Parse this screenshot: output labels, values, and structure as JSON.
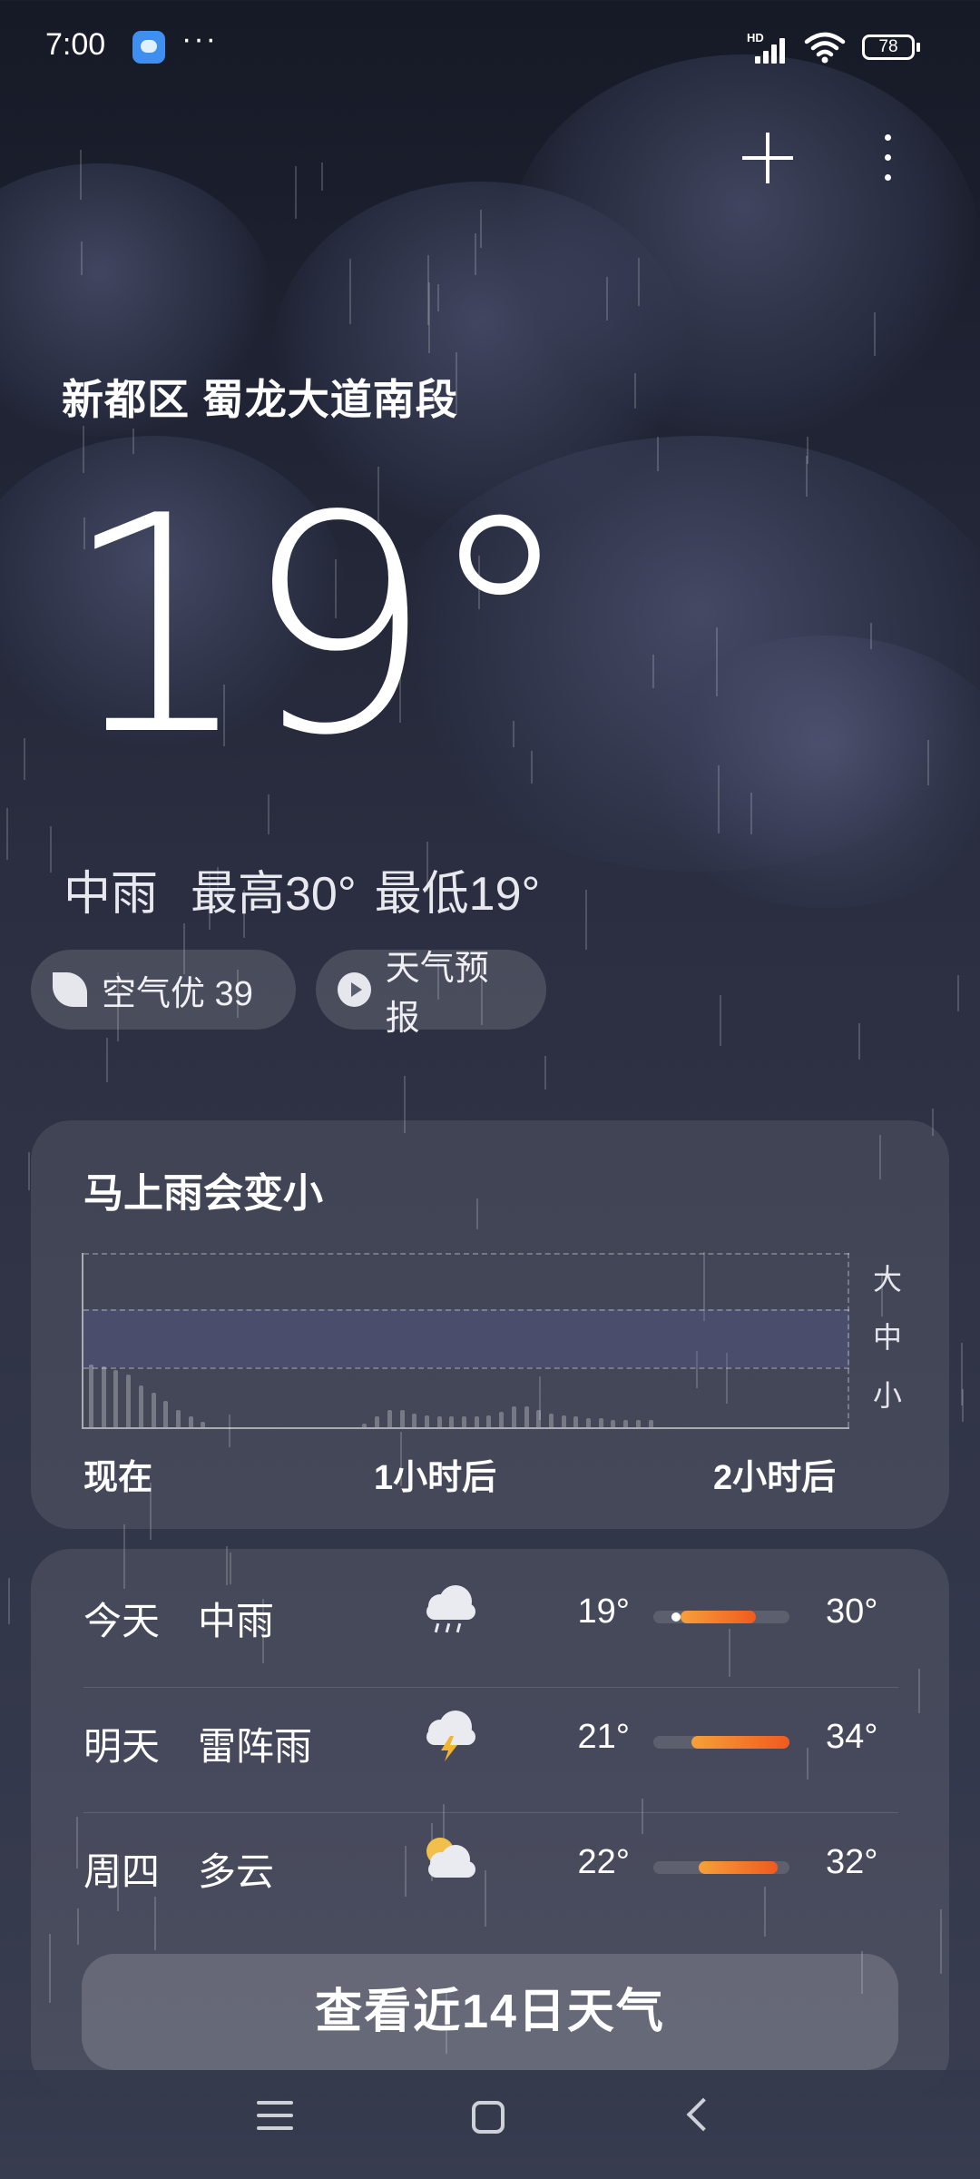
{
  "status_bar": {
    "time": "7:00",
    "dots": "···",
    "hd": "HD",
    "battery": "78"
  },
  "header": {
    "add_icon": "plus-icon",
    "more_icon": "more-vertical-icon"
  },
  "current": {
    "location": "新都区 蜀龙大道南段",
    "temperature": "19°",
    "condition": "中雨",
    "high": "最高30°",
    "low": "最低19°",
    "air_quality": "空气优 39",
    "forecast_button": "天气预报"
  },
  "rain_card": {
    "title": "马上雨会变小",
    "y_levels": [
      "大",
      "中",
      "小"
    ],
    "x_labels": [
      "现在",
      "1小时后",
      "2小时后"
    ]
  },
  "chart_data": {
    "type": "bar",
    "title": "马上雨会变小",
    "x_ticks": [
      "现在",
      "1小时后",
      "2小时后"
    ],
    "y_ticks": [
      "大",
      "中",
      "小"
    ],
    "values": [
      0.36,
      0.35,
      0.33,
      0.3,
      0.24,
      0.2,
      0.15,
      0.1,
      0.06,
      0.03,
      0,
      0,
      0,
      0,
      0,
      0,
      0,
      0,
      0,
      0,
      0,
      0,
      0.02,
      0.06,
      0.1,
      0.1,
      0.08,
      0.07,
      0.06,
      0.06,
      0.06,
      0.06,
      0.07,
      0.09,
      0.12,
      0.12,
      0.1,
      0.08,
      0.07,
      0.06,
      0.05,
      0.05,
      0.04,
      0.04,
      0.04,
      0.04,
      0,
      0,
      0,
      0,
      0,
      0,
      0,
      0,
      0,
      0,
      0,
      0,
      0,
      0
    ]
  },
  "daily": [
    {
      "day": "今天",
      "condition": "中雨",
      "icon": "rain-cloud-icon",
      "low": "19°",
      "high": "30°",
      "range_start": 0.2,
      "range_end": 0.75,
      "current_pos": 0.13
    },
    {
      "day": "明天",
      "condition": "雷阵雨",
      "icon": "thunderstorm-icon",
      "low": "21°",
      "high": "34°",
      "range_start": 0.28,
      "range_end": 1.0
    },
    {
      "day": "周四",
      "condition": "多云",
      "icon": "partly-cloudy-icon",
      "low": "22°",
      "high": "32°",
      "range_start": 0.33,
      "range_end": 0.91
    }
  ],
  "view_14_days": "查看近14日天气",
  "navbar": {
    "menu_icon": "menu-icon",
    "home_icon": "home-icon",
    "back_icon": "back-icon"
  }
}
